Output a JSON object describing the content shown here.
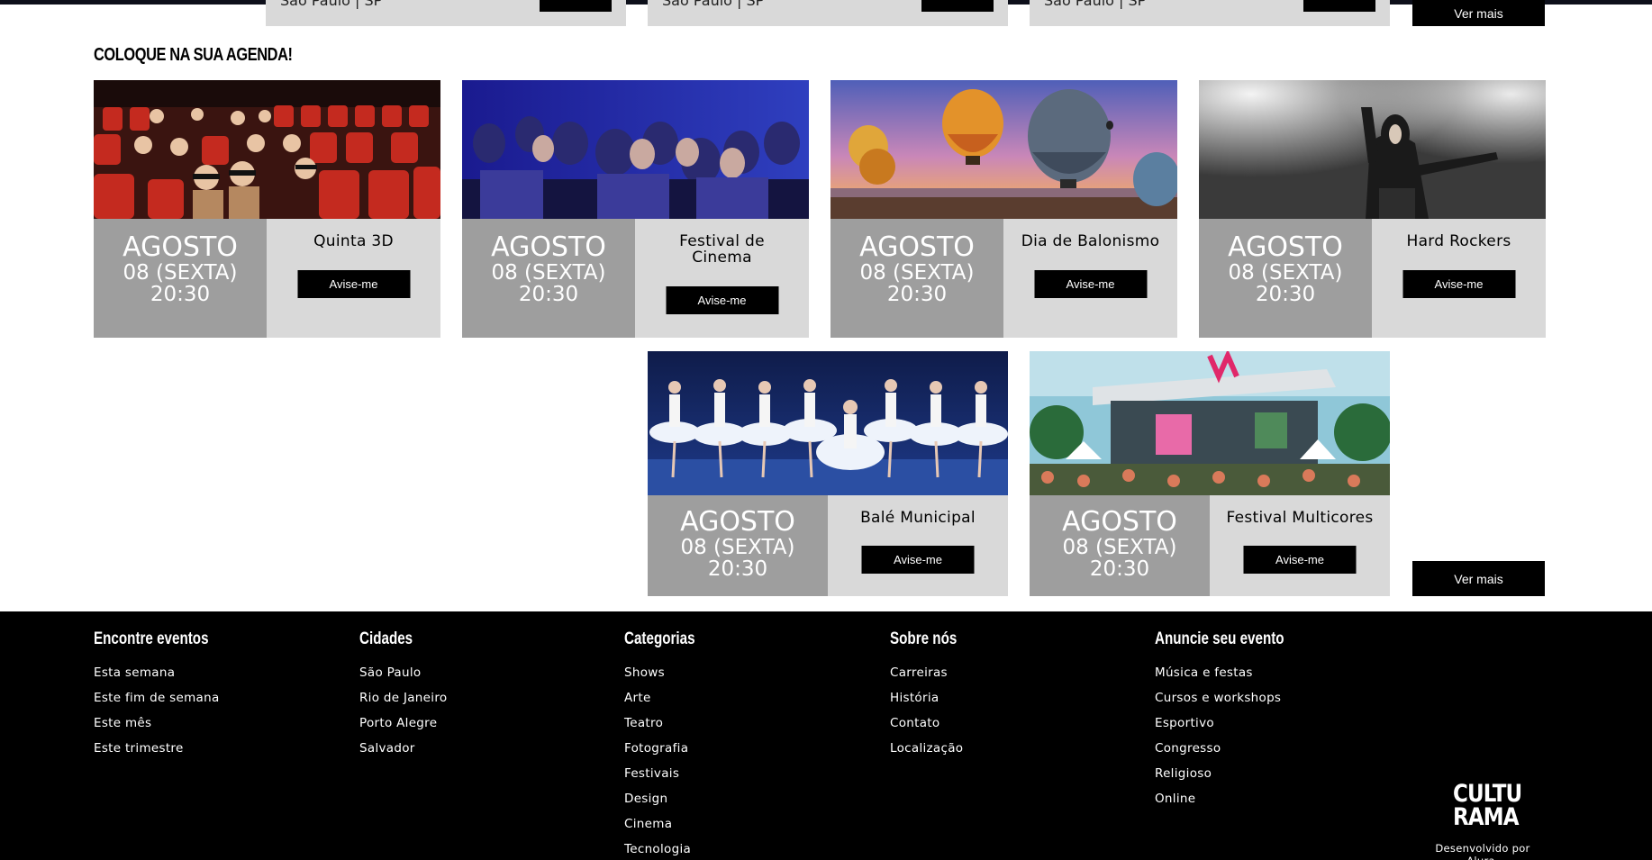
{
  "top_row": {
    "cards": [
      {
        "location": "São Paulo | SP"
      },
      {
        "location": "São Paulo | SP"
      },
      {
        "location": "São Paulo | SP"
      }
    ],
    "more_label": "Ver mais"
  },
  "agenda": {
    "title": "COLOQUE NA SUA AGENDA!",
    "events": [
      {
        "month": "AGOSTO",
        "day": "08 (SEXTA)",
        "time": "20:30",
        "title": "Quinta 3D",
        "button": "Avise-me"
      },
      {
        "month": "AGOSTO",
        "day": "08 (SEXTA)",
        "time": "20:30",
        "title": "Festival de Cinema",
        "button": "Avise-me"
      },
      {
        "month": "AGOSTO",
        "day": "08 (SEXTA)",
        "time": "20:30",
        "title": "Dia de Balonismo",
        "button": "Avise-me"
      },
      {
        "month": "AGOSTO",
        "day": "08 (SEXTA)",
        "time": "20:30",
        "title": "Hard Rockers",
        "button": "Avise-me"
      },
      {
        "month": "AGOSTO",
        "day": "08 (SEXTA)",
        "time": "20:30",
        "title": "Balé Municipal",
        "button": "Avise-me"
      },
      {
        "month": "AGOSTO",
        "day": "08 (SEXTA)",
        "time": "20:30",
        "title": "Festival Multicores",
        "button": "Avise-me"
      }
    ],
    "more_label": "Ver mais"
  },
  "footer": {
    "columns": [
      {
        "title": "Encontre eventos",
        "links": [
          "Esta semana",
          "Este fim de semana",
          "Este mês",
          "Este trimestre"
        ]
      },
      {
        "title": "Cidades",
        "links": [
          "São Paulo",
          "Rio de Janeiro",
          "Porto Alegre",
          "Salvador"
        ]
      },
      {
        "title": "Categorias",
        "links": [
          "Shows",
          "Arte",
          "Teatro",
          "Fotografia",
          "Festivais",
          "Design",
          "Cinema",
          "Tecnologia"
        ]
      },
      {
        "title": "Sobre nós",
        "links": [
          "Carreiras",
          "História",
          "Contato",
          "Localização"
        ]
      },
      {
        "title": "Anuncie seu evento",
        "links": [
          "Música e festas",
          "Cursos e workshops",
          "Esportivo",
          "Congresso",
          "Religioso",
          "Online"
        ]
      }
    ],
    "logo_line1": "CULTU",
    "logo_line2": "RAMA",
    "credit": "Desenvolvido por Alura."
  },
  "colors": {
    "date_panel": "#9e9e9e",
    "info_panel": "#d9d9d9",
    "button": "#000000",
    "footer": "#000000"
  }
}
